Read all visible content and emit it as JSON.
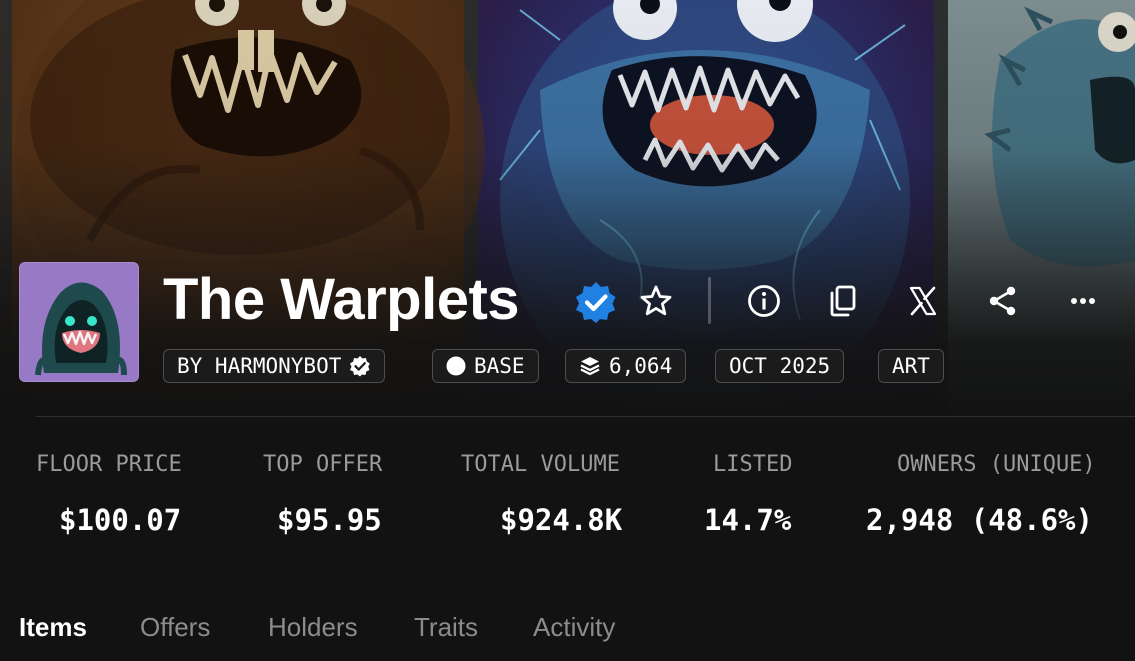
{
  "collection": {
    "name": "The Warplets",
    "verified": true,
    "tags": {
      "creator": "BY HARMONYBOT",
      "chain": "BASE",
      "supply": "6,064",
      "date": "OCT 2025",
      "category": "ART"
    }
  },
  "header_actions": [
    "favorite-star",
    "info",
    "copy",
    "x-share",
    "share",
    "more"
  ],
  "stats": {
    "floor_price": {
      "label": "FLOOR PRICE",
      "value": "$100.07"
    },
    "top_offer": {
      "label": "TOP OFFER",
      "value": "$95.95"
    },
    "total_volume": {
      "label": "TOTAL VOLUME",
      "value": "$924.8K"
    },
    "listed": {
      "label": "LISTED",
      "value": "14.7%"
    },
    "owners": {
      "label": "OWNERS (UNIQUE)",
      "value": "2,948 (48.6%)"
    }
  },
  "tabs": {
    "items": "Items",
    "offers": "Offers",
    "holders": "Holders",
    "traits": "Traits",
    "activity": "Activity",
    "active": "Items"
  },
  "colors": {
    "background": "#121212",
    "verified_badge": "#2081e2",
    "avatar_bg": "#9879c5",
    "muted_text": "#9a9a9a"
  }
}
